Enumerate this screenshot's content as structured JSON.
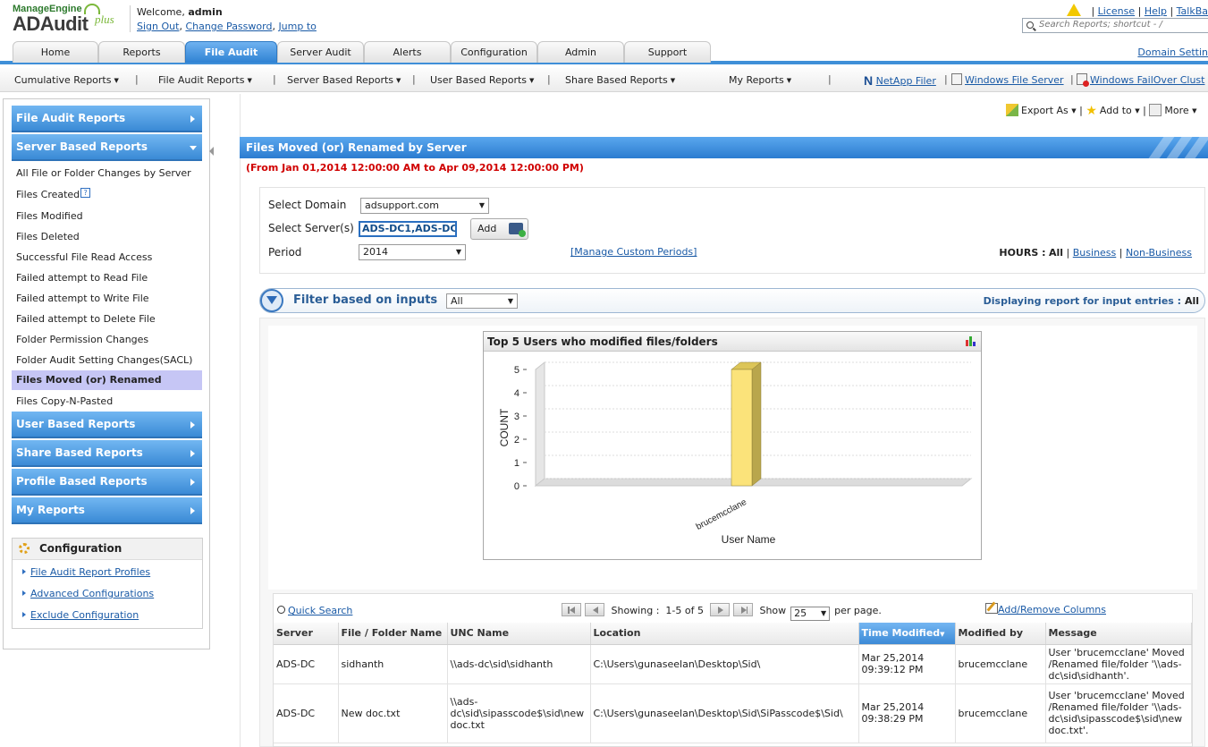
{
  "brand": {
    "vendor": "ManageEngine",
    "product": "ADAudit",
    "suffix": "plus"
  },
  "header": {
    "welcome_prefix": "Welcome,",
    "user": "admin",
    "sign_out": "Sign Out",
    "change_password": "Change Password",
    "jump_to": "Jump to",
    "links": [
      "License",
      "Help",
      "TalkBa"
    ],
    "search_placeholder": "Search Reports; shortcut - /"
  },
  "tabs": [
    {
      "label": "Home"
    },
    {
      "label": "Reports"
    },
    {
      "label": "File Audit",
      "active": true
    },
    {
      "label": "Server Audit"
    },
    {
      "label": "Alerts"
    },
    {
      "label": "Configuration"
    },
    {
      "label": "Admin"
    },
    {
      "label": "Support"
    }
  ],
  "domain_settings": "Domain Settin",
  "report_menu": [
    "Cumulative Reports",
    "File Audit Reports",
    "Server Based Reports",
    "User Based Reports",
    "Share Based Reports",
    "My Reports"
  ],
  "server_links": [
    "NetApp Filer",
    "Windows File Server",
    "Windows FailOver Clust"
  ],
  "sidebar": {
    "sections_top": [
      {
        "label": "File Audit Reports",
        "expanded": false
      },
      {
        "label": "Server Based Reports",
        "expanded": true
      }
    ],
    "items": [
      "All File or Folder Changes by Server",
      "Files Created",
      "Files Modified",
      "Files Deleted",
      "Successful File Read Access",
      "Failed attempt to Read File",
      "Failed attempt to Write File",
      "Failed attempt to Delete File",
      "Folder Permission Changes",
      "Folder Audit Setting Changes(SACL)",
      "Files Moved (or) Renamed",
      "Files Copy-N-Pasted"
    ],
    "selected_item": "Files Moved (or) Renamed",
    "sections_bottom": [
      "User Based Reports",
      "Share Based Reports",
      "Profile Based Reports",
      "My Reports"
    ],
    "config_title": "Configuration",
    "config_links": [
      "File Audit Report Profiles",
      "Advanced Configurations",
      "Exclude Configuration"
    ]
  },
  "actions": {
    "export": "Export As",
    "add_to": "Add to",
    "more": "More"
  },
  "report": {
    "title": "Files Moved (or) Renamed by Server",
    "date_range": "(From Jan 01,2014 12:00:00 AM to Apr 09,2014 12:00:00 PM)"
  },
  "filters": {
    "domain_label": "Select Domain",
    "domain_value": "adsupport.com",
    "server_label": "Select Server(s)",
    "server_value": "ADS-DC1,ADS-DC",
    "add_label": "Add",
    "period_label": "Period",
    "period_value": "2014",
    "custom_periods": "[Manage Custom Periods]",
    "hours_label": "HOURS :",
    "hours_all": "All",
    "hours_business": "Business",
    "hours_nonbusiness": "Non-Business"
  },
  "filter_bar": {
    "label": "Filter based on inputs",
    "select_value": "All",
    "display_prefix": "Displaying report for input entries :",
    "display_value": "All"
  },
  "chart_data": {
    "type": "bar",
    "title": "Top 5 Users who modified files/folders",
    "categories": [
      "brucemcclane"
    ],
    "values": [
      5
    ],
    "xlabel": "User Name",
    "ylabel": "COUNT",
    "ylim": [
      0,
      5
    ],
    "yticks": [
      0,
      1,
      2,
      3,
      4,
      5
    ],
    "grid": true,
    "colors": {
      "bar_front": "#fbe37a",
      "bar_side": "#b9a64c",
      "bar_top": "#dcc558"
    }
  },
  "grid": {
    "quick_search": "Quick Search",
    "showing_label": "Showing :",
    "showing_value": "1-5 of 5",
    "show_label": "Show",
    "page_size": "25",
    "per_page": "per page.",
    "add_remove": "Add/Remove Columns",
    "columns": [
      "Server",
      "File / Folder Name",
      "UNC Name",
      "Location",
      "Time Modified",
      "Modified by",
      "Message"
    ],
    "sorted_column": "Time Modified",
    "rows": [
      {
        "server": "ADS-DC",
        "file": "sidhanth",
        "unc": "\\\\ads-dc\\sid\\sidhanth",
        "location": "C:\\Users\\gunaseelan\\Desktop\\Sid\\",
        "time": "Mar 25,2014 09:39:12 PM",
        "by": "brucemcclane",
        "message": "User 'brucemcclane' Moved /Renamed file/folder '\\\\ads-dc\\sid\\sidhanth'."
      },
      {
        "server": "ADS-DC",
        "file": "New doc.txt",
        "unc": "\\\\ads-dc\\sid\\sipasscode$\\sid\\new doc.txt",
        "location": "C:\\Users\\gunaseelan\\Desktop\\Sid\\SiPasscode$\\Sid\\",
        "time": "Mar 25,2014 09:38:29 PM",
        "by": "brucemcclane",
        "message": "User 'brucemcclane' Moved /Renamed file/folder '\\\\ads-dc\\sid\\sipasscode$\\sid\\new doc.txt'."
      }
    ]
  }
}
